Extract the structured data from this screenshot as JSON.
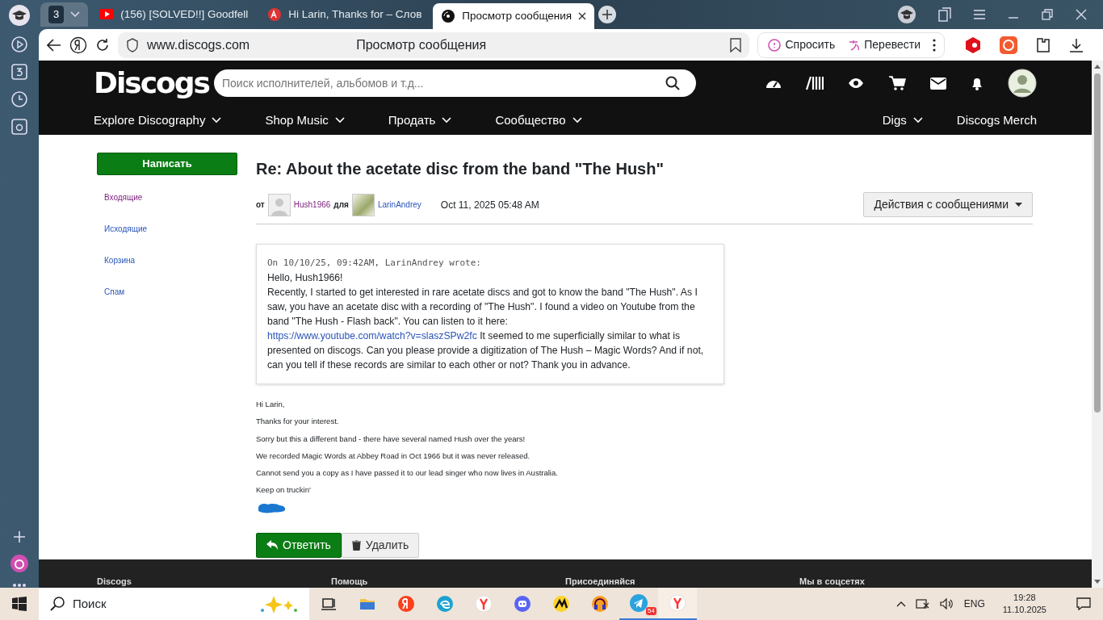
{
  "browser": {
    "tab_group_count": "3",
    "tabs": [
      {
        "title": "(156) [SOLVED!!] Goodfell",
        "kind": "video",
        "selected": false
      },
      {
        "title": "Hi Larin, Thanks for – Слов",
        "kind": "translate",
        "selected": false
      },
      {
        "title": "Просмотр сообщения",
        "kind": "record",
        "selected": true
      }
    ],
    "address": "www.discogs.com",
    "page_title": "Просмотр сообщения",
    "ask": "Спросить",
    "translate": "Перевести"
  },
  "site": {
    "logo": "Discogs",
    "search_placeholder": "Поиск исполнителей, альбомов и т.д...",
    "nav": [
      "Explore Discography",
      "Shop Music",
      "Продать",
      "Сообщество"
    ],
    "nav_right": [
      "Digs",
      "Discogs Merch"
    ]
  },
  "sidebar": {
    "compose": "Написать",
    "folders": [
      {
        "label": "Входящие",
        "selected": true
      },
      {
        "label": "Исходящие",
        "selected": false
      },
      {
        "label": "Корзина",
        "selected": false
      },
      {
        "label": "Спам",
        "selected": false
      }
    ]
  },
  "message": {
    "subject": "Re: About the acetate disc from the band \"The Hush\"",
    "from_label": "от",
    "from": "Hush1966",
    "to_label": "для",
    "to": "LarinAndrey",
    "date": "Oct 11, 2025 05:48 AM",
    "actions": "Действия с сообщениями",
    "quote": {
      "header": "On 10/10/25, 09:42AM, LarinAndrey wrote:",
      "greeting": "Hello, Hush1966!",
      "text_before_link": "Recently, I started to get interested in rare acetate discs and got to know the band \"The Hush\". As I saw, you have an acetate disc with a recording of \"The Hush\". I found a video on Youtube from the band \"The Hush - Flash back\". You can listen to it here:",
      "link": "https://www.youtube.com/watch?v=slaszSPw2fc",
      "text_after_link": "It seemed to me superficially similar to what is presented on discogs. Can you please provide a digitization of The Hush – Magic Words? And if not, can you tell if these records are similar to each other or not? Thank you in advance."
    },
    "body": [
      "Hi Larin,",
      "Thanks for your interest.",
      "Sorry but this a different band - there have several named Hush over the years!",
      "We recorded Magic Words at Abbey Road in Oct 1966 but it was never released.",
      "Cannot send you a copy as I have passed it to our lead singer who now lives in Australia.",
      "Keep on truckin'"
    ],
    "reply": "Ответить",
    "delete": "Удалить"
  },
  "footer": [
    "Discogs",
    "Помощь",
    "Присоединяйся",
    "Мы в соцсетях"
  ],
  "taskbar": {
    "search": "Поиск",
    "telegram_badge": "54",
    "language": "ENG",
    "time": "19:28",
    "date": "11.10.2025"
  }
}
